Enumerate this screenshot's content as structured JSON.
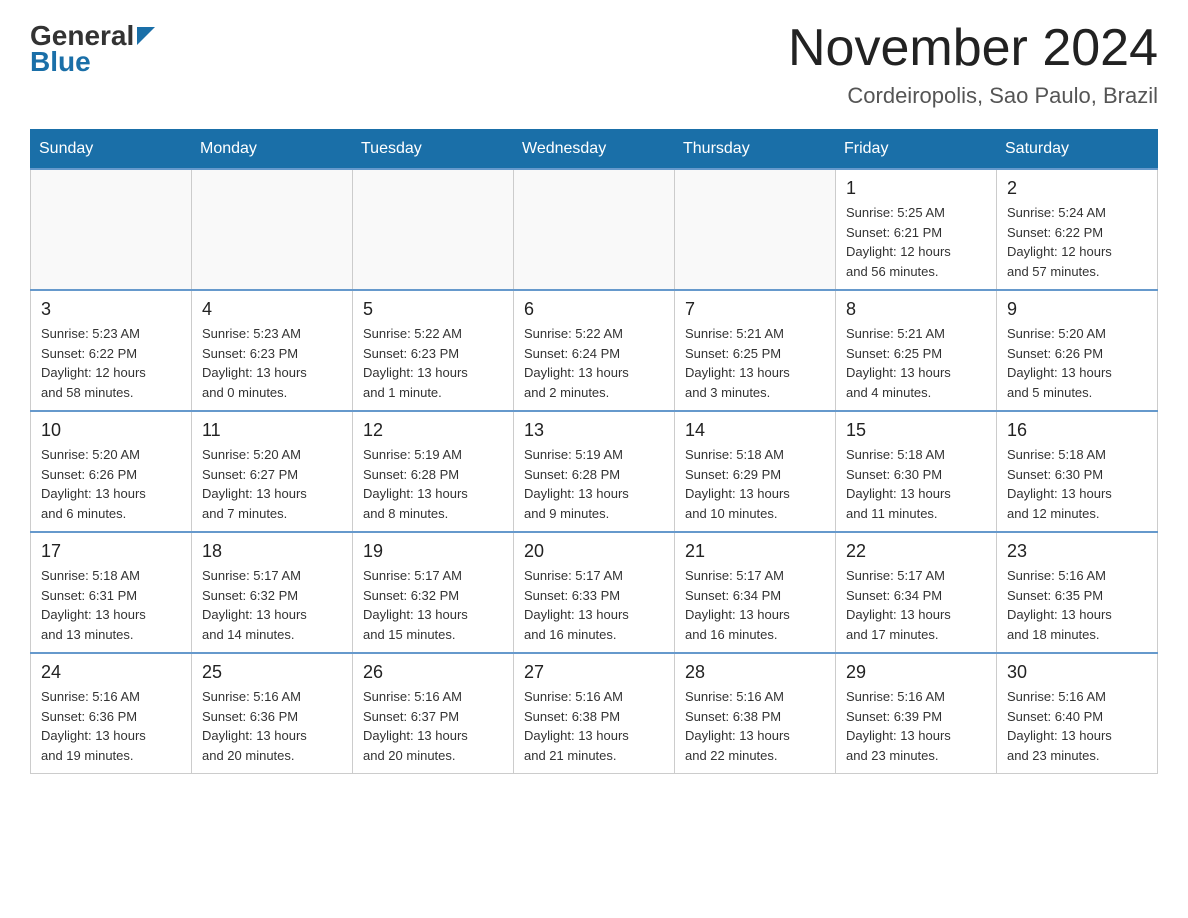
{
  "header": {
    "logo_general": "General",
    "logo_blue": "Blue",
    "month_title": "November 2024",
    "location": "Cordeiropolis, Sao Paulo, Brazil"
  },
  "weekdays": [
    "Sunday",
    "Monday",
    "Tuesday",
    "Wednesday",
    "Thursday",
    "Friday",
    "Saturday"
  ],
  "weeks": [
    [
      {
        "day": "",
        "info": ""
      },
      {
        "day": "",
        "info": ""
      },
      {
        "day": "",
        "info": ""
      },
      {
        "day": "",
        "info": ""
      },
      {
        "day": "",
        "info": ""
      },
      {
        "day": "1",
        "info": "Sunrise: 5:25 AM\nSunset: 6:21 PM\nDaylight: 12 hours\nand 56 minutes."
      },
      {
        "day": "2",
        "info": "Sunrise: 5:24 AM\nSunset: 6:22 PM\nDaylight: 12 hours\nand 57 minutes."
      }
    ],
    [
      {
        "day": "3",
        "info": "Sunrise: 5:23 AM\nSunset: 6:22 PM\nDaylight: 12 hours\nand 58 minutes."
      },
      {
        "day": "4",
        "info": "Sunrise: 5:23 AM\nSunset: 6:23 PM\nDaylight: 13 hours\nand 0 minutes."
      },
      {
        "day": "5",
        "info": "Sunrise: 5:22 AM\nSunset: 6:23 PM\nDaylight: 13 hours\nand 1 minute."
      },
      {
        "day": "6",
        "info": "Sunrise: 5:22 AM\nSunset: 6:24 PM\nDaylight: 13 hours\nand 2 minutes."
      },
      {
        "day": "7",
        "info": "Sunrise: 5:21 AM\nSunset: 6:25 PM\nDaylight: 13 hours\nand 3 minutes."
      },
      {
        "day": "8",
        "info": "Sunrise: 5:21 AM\nSunset: 6:25 PM\nDaylight: 13 hours\nand 4 minutes."
      },
      {
        "day": "9",
        "info": "Sunrise: 5:20 AM\nSunset: 6:26 PM\nDaylight: 13 hours\nand 5 minutes."
      }
    ],
    [
      {
        "day": "10",
        "info": "Sunrise: 5:20 AM\nSunset: 6:26 PM\nDaylight: 13 hours\nand 6 minutes."
      },
      {
        "day": "11",
        "info": "Sunrise: 5:20 AM\nSunset: 6:27 PM\nDaylight: 13 hours\nand 7 minutes."
      },
      {
        "day": "12",
        "info": "Sunrise: 5:19 AM\nSunset: 6:28 PM\nDaylight: 13 hours\nand 8 minutes."
      },
      {
        "day": "13",
        "info": "Sunrise: 5:19 AM\nSunset: 6:28 PM\nDaylight: 13 hours\nand 9 minutes."
      },
      {
        "day": "14",
        "info": "Sunrise: 5:18 AM\nSunset: 6:29 PM\nDaylight: 13 hours\nand 10 minutes."
      },
      {
        "day": "15",
        "info": "Sunrise: 5:18 AM\nSunset: 6:30 PM\nDaylight: 13 hours\nand 11 minutes."
      },
      {
        "day": "16",
        "info": "Sunrise: 5:18 AM\nSunset: 6:30 PM\nDaylight: 13 hours\nand 12 minutes."
      }
    ],
    [
      {
        "day": "17",
        "info": "Sunrise: 5:18 AM\nSunset: 6:31 PM\nDaylight: 13 hours\nand 13 minutes."
      },
      {
        "day": "18",
        "info": "Sunrise: 5:17 AM\nSunset: 6:32 PM\nDaylight: 13 hours\nand 14 minutes."
      },
      {
        "day": "19",
        "info": "Sunrise: 5:17 AM\nSunset: 6:32 PM\nDaylight: 13 hours\nand 15 minutes."
      },
      {
        "day": "20",
        "info": "Sunrise: 5:17 AM\nSunset: 6:33 PM\nDaylight: 13 hours\nand 16 minutes."
      },
      {
        "day": "21",
        "info": "Sunrise: 5:17 AM\nSunset: 6:34 PM\nDaylight: 13 hours\nand 16 minutes."
      },
      {
        "day": "22",
        "info": "Sunrise: 5:17 AM\nSunset: 6:34 PM\nDaylight: 13 hours\nand 17 minutes."
      },
      {
        "day": "23",
        "info": "Sunrise: 5:16 AM\nSunset: 6:35 PM\nDaylight: 13 hours\nand 18 minutes."
      }
    ],
    [
      {
        "day": "24",
        "info": "Sunrise: 5:16 AM\nSunset: 6:36 PM\nDaylight: 13 hours\nand 19 minutes."
      },
      {
        "day": "25",
        "info": "Sunrise: 5:16 AM\nSunset: 6:36 PM\nDaylight: 13 hours\nand 20 minutes."
      },
      {
        "day": "26",
        "info": "Sunrise: 5:16 AM\nSunset: 6:37 PM\nDaylight: 13 hours\nand 20 minutes."
      },
      {
        "day": "27",
        "info": "Sunrise: 5:16 AM\nSunset: 6:38 PM\nDaylight: 13 hours\nand 21 minutes."
      },
      {
        "day": "28",
        "info": "Sunrise: 5:16 AM\nSunset: 6:38 PM\nDaylight: 13 hours\nand 22 minutes."
      },
      {
        "day": "29",
        "info": "Sunrise: 5:16 AM\nSunset: 6:39 PM\nDaylight: 13 hours\nand 23 minutes."
      },
      {
        "day": "30",
        "info": "Sunrise: 5:16 AM\nSunset: 6:40 PM\nDaylight: 13 hours\nand 23 minutes."
      }
    ]
  ]
}
